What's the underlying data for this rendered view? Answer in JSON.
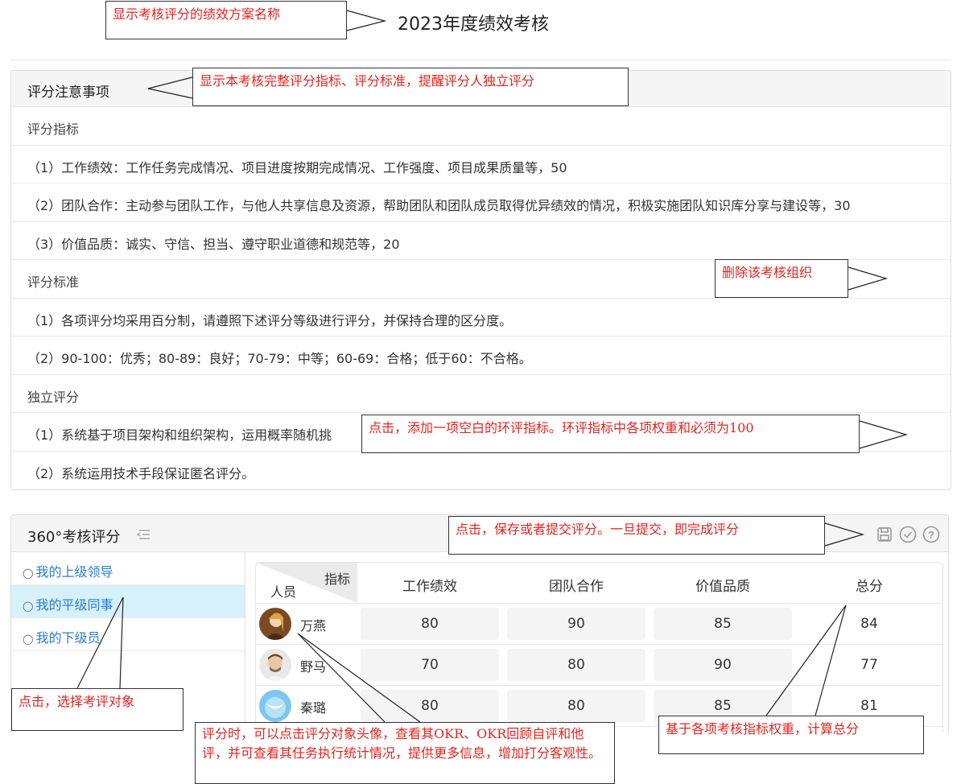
{
  "page": {
    "title": "2023年度绩效考核"
  },
  "notes": {
    "heading": "评分注意事项",
    "rows": [
      {
        "text": "评分指标",
        "kind": "section"
      },
      {
        "text": "（1）工作绩效：工作任务完成情况、项目进度按期完成情况、工作强度、项目成果质量等，50",
        "kind": "item"
      },
      {
        "text": "（2）团队合作：主动参与团队工作，与他人共享信息及资源，帮助团队和团队成员取得优异绩效的情况，积极实施团队知识库分享与建设等，30",
        "kind": "item"
      },
      {
        "text": "（3）价值品质：诚实、守信、担当、遵守职业道德和规范等，20",
        "kind": "item"
      },
      {
        "text": "评分标准",
        "kind": "section"
      },
      {
        "text": "（1）各项评分均采用百分制，请遵照下述评分等级进行评分，并保持合理的区分度。",
        "kind": "item"
      },
      {
        "text": "（2）90-100：优秀；80-89：良好；70-79：中等；60-69：合格；低于60：不合格。",
        "kind": "item"
      },
      {
        "text": "独立评分",
        "kind": "section"
      },
      {
        "text": "（1）系统基于项目架构和组织架构，运用概率随机挑",
        "kind": "item"
      },
      {
        "text": "（2）系统运用技术手段保证匿名评分。",
        "kind": "item"
      }
    ]
  },
  "evaluation": {
    "title": "360°考核评分",
    "icons": [
      "collapse-icon",
      "save-icon",
      "submit-check-icon",
      "help-icon"
    ],
    "sidebar": [
      {
        "label": "我的上级领导",
        "active": false
      },
      {
        "label": "我的平级同事",
        "active": true
      },
      {
        "label": "我的下级员",
        "active": false
      }
    ],
    "table": {
      "corner_top": "指标",
      "corner_bottom": "人员",
      "columns": [
        "工作绩效",
        "团队合作",
        "价值品质",
        "总分"
      ],
      "rows": [
        {
          "name": "万燕",
          "avatar": "avatar-woman",
          "scores": [
            "80",
            "90",
            "85"
          ],
          "total": "84"
        },
        {
          "name": "野马",
          "avatar": "avatar-man",
          "scores": [
            "70",
            "80",
            "90"
          ],
          "total": "77"
        },
        {
          "name": "秦璐",
          "avatar": "avatar-bird",
          "scores": [
            "80",
            "80",
            "85"
          ],
          "total": "81"
        }
      ]
    }
  },
  "annotations": {
    "a1": "显示考核评分的绩效方案名称",
    "a2": "显示本考核完整评分指标、评分标准，提醒评分人独立评分",
    "a3": "删除该考核组织",
    "a4": "点击，添加一项空白的环评指标。环评指标中各项权重和必须为100",
    "a5": "点击，保存或者提交评分。一旦提交，即完成评分",
    "a6": "点击，选择考评对象",
    "a7": "评分时，可以点击评分对象头像，查看其OKR、OKR回顾自评和他评，并可查看其任务执行统计情况，提供更多信息，增加打分客观性。",
    "a8": "基于各项考核指标权重，计算总分"
  },
  "colors": {
    "annotation_text": "#e4241f",
    "link": "#2e7bd6",
    "active_bg": "#d6f1fa"
  }
}
